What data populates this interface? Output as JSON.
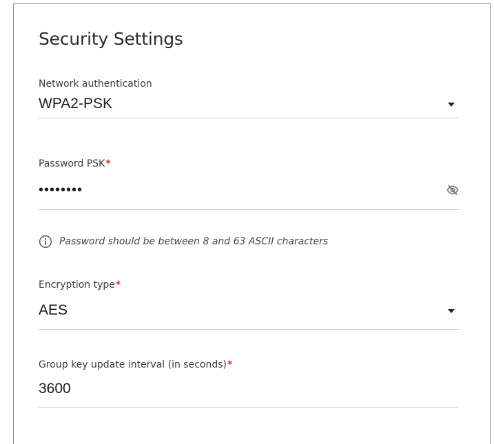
{
  "section": {
    "title": "Security Settings"
  },
  "fields": {
    "network_auth": {
      "label": "Network authentication",
      "value": "WPA2-PSK"
    },
    "password": {
      "label": "Password PSK",
      "required_mark": "*",
      "value": "••••••••",
      "toggle_icon": "eye-off-icon"
    },
    "password_hint": {
      "icon": "info-icon",
      "text": "Password should be between 8 and 63 ASCII characters"
    },
    "encryption": {
      "label": "Encryption type",
      "required_mark": "*",
      "value": "AES"
    },
    "group_key": {
      "label": "Group key update interval (in seconds)",
      "required_mark": "*",
      "value": "3600"
    }
  },
  "colors": {
    "required": "#d9342b",
    "divider": "#c9c9c9",
    "text": "#1a1a1a"
  }
}
